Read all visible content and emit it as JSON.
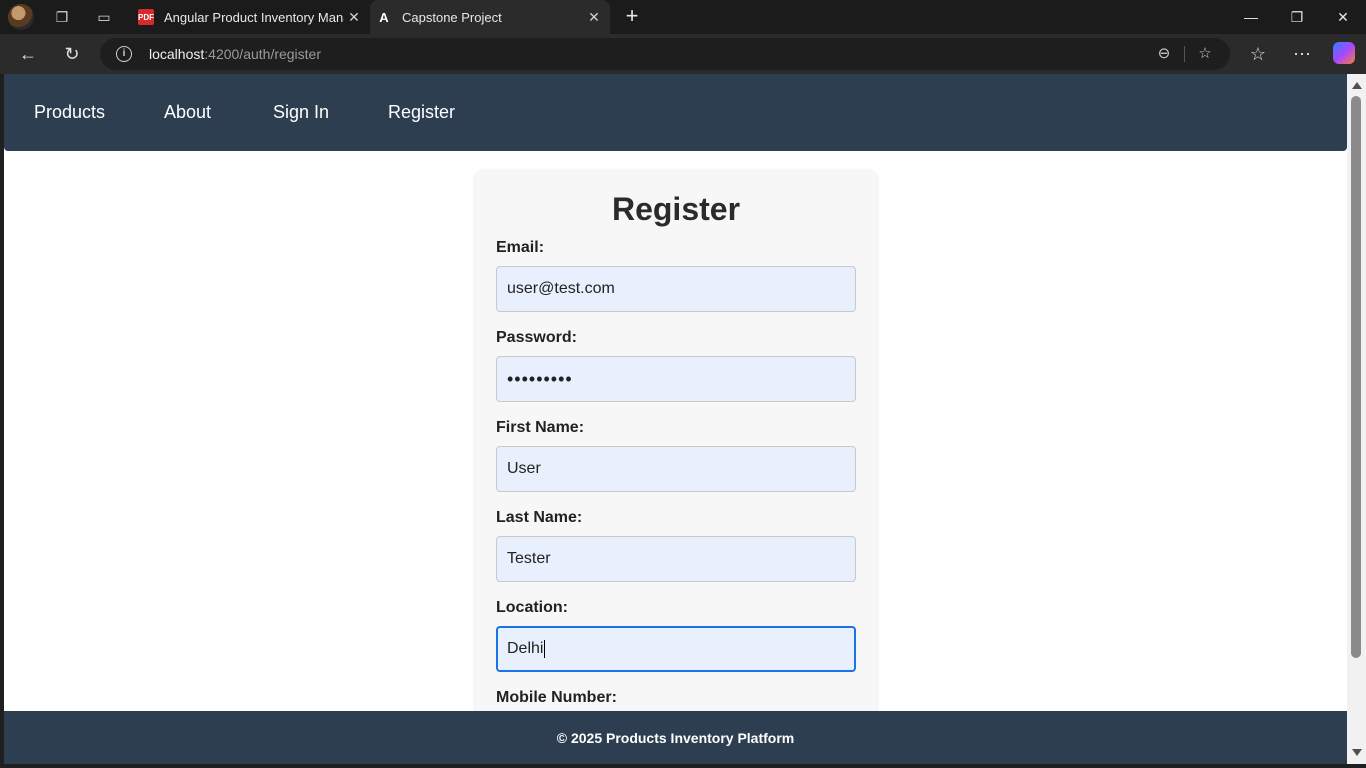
{
  "browser": {
    "tabs": [
      {
        "title": "Angular Product Inventory Manag",
        "favicon": "pdf-icon",
        "active": false
      },
      {
        "title": "Capstone Project",
        "favicon": "angular-icon",
        "active": true
      }
    ],
    "url_host": "localhost",
    "url_rest": ":4200/auth/register"
  },
  "nav": {
    "items": [
      "Products",
      "About",
      "Sign In",
      "Register"
    ]
  },
  "form": {
    "title": "Register",
    "fields": [
      {
        "label": "Email:",
        "value": "user@test.com"
      },
      {
        "label": "Password:",
        "value": "•••••••••"
      },
      {
        "label": "First Name:",
        "value": "User"
      },
      {
        "label": "Last Name:",
        "value": "Tester"
      },
      {
        "label": "Location:",
        "value": "Delhi"
      },
      {
        "label": "Mobile Number:",
        "value": ""
      }
    ]
  },
  "footer": {
    "text": "© 2025 Products Inventory Platform"
  },
  "colors": {
    "nav_bg": "#2c3e50",
    "input_bg": "#e8f0fe",
    "focus_border": "#1a73e8"
  }
}
